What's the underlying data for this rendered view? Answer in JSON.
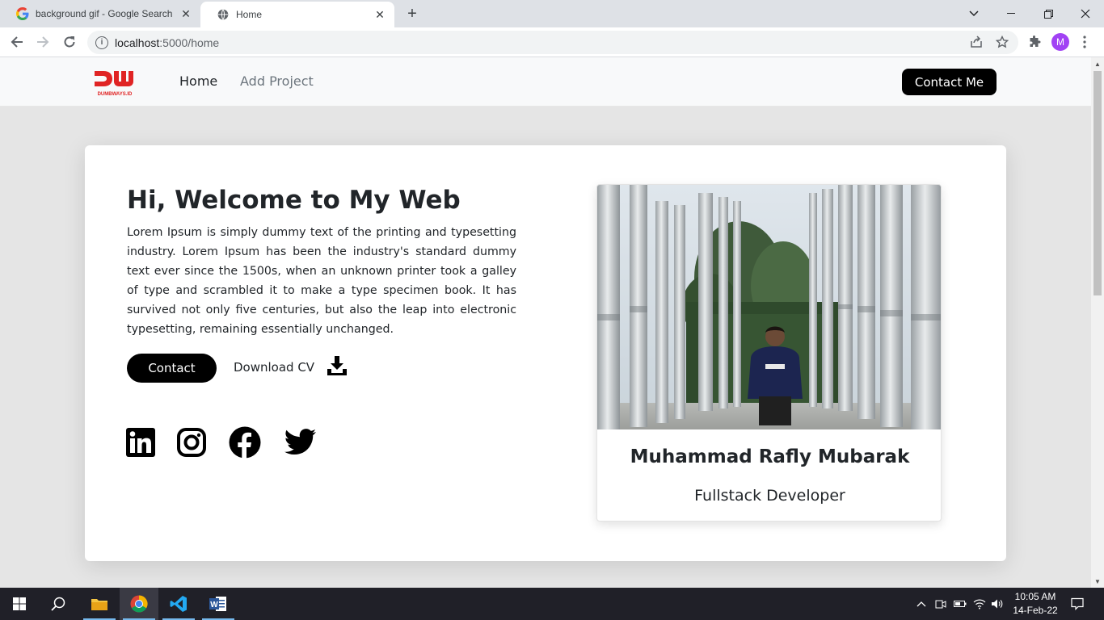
{
  "browser": {
    "tabs": [
      {
        "title": "background gif - Google Search",
        "icon": "google-icon"
      },
      {
        "title": "Home",
        "icon": "globe-icon"
      }
    ],
    "url_host": "localhost",
    "url_rest": ":5000/home",
    "profile_initial": "M"
  },
  "site": {
    "logo_text": "DUMBWAYS.ID",
    "nav": {
      "home": "Home",
      "add_project": "Add Project",
      "contact_me": "Contact Me"
    },
    "hero": {
      "title": "Hi, Welcome to My Web",
      "text": "Lorem Ipsum is simply dummy text of the printing and typesetting industry. Lorem Ipsum has been the industry's standard dummy text ever since the 1500s, when an unknown printer took a galley of type and scrambled it to make a type specimen book. It has survived not only five centuries, but also the leap into electronic typesetting, remaining essentially unchanged.",
      "contact_label": "Contact",
      "download_label": "Download CV"
    },
    "social": [
      "linkedin-icon",
      "instagram-icon",
      "facebook-icon",
      "twitter-icon"
    ],
    "profile": {
      "name": "Muhammad Rafly Mubarak",
      "role": "Fullstack Developer"
    }
  },
  "taskbar": {
    "time": "10:05 AM",
    "date": "14-Feb-22"
  },
  "colors": {
    "accent": "#000000",
    "logo_red": "#e02424",
    "chrome_tab_bg": "#dee1e6"
  }
}
